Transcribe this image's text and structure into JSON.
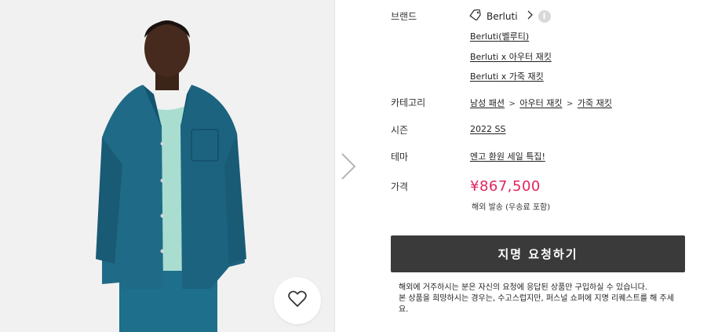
{
  "labels": {
    "brand": "브랜드",
    "category": "카테고리",
    "season": "시즌",
    "theme": "테마",
    "price": "가격"
  },
  "brand": {
    "name": "Berluti",
    "links": [
      "Berluti(벨루티)",
      "Berluti x 아우터 재킷",
      "Berluti x 가죽 재킷"
    ]
  },
  "category": {
    "path": [
      "남성 패션",
      "아우터 재킷",
      "가죽 재킷"
    ],
    "separator": ">"
  },
  "season": "2022 SS",
  "theme": "엔고 환원 세일 특집!",
  "price": "¥867,500",
  "shipping": "해외 발송 (우송료 포함)",
  "request_button": "지명 요청하기",
  "note": [
    "해외에 거주하시는 분은 자신의 요청에 응답된 상품만 구입하실 수 있습니다.",
    "본 상품을 희망하시는 경우는, 수고스럽지만, 퍼스널 쇼퍼에 지명 리퀘스트를 해 주세요."
  ],
  "colors": {
    "price": "#e0245e",
    "button": "#3a3a3a",
    "jacket": "#1f6a86",
    "shirt": "#a8ddd0"
  },
  "icons": [
    "tag-icon",
    "chevron-right-icon",
    "info-icon",
    "next-arrow-icon",
    "heart-icon"
  ]
}
